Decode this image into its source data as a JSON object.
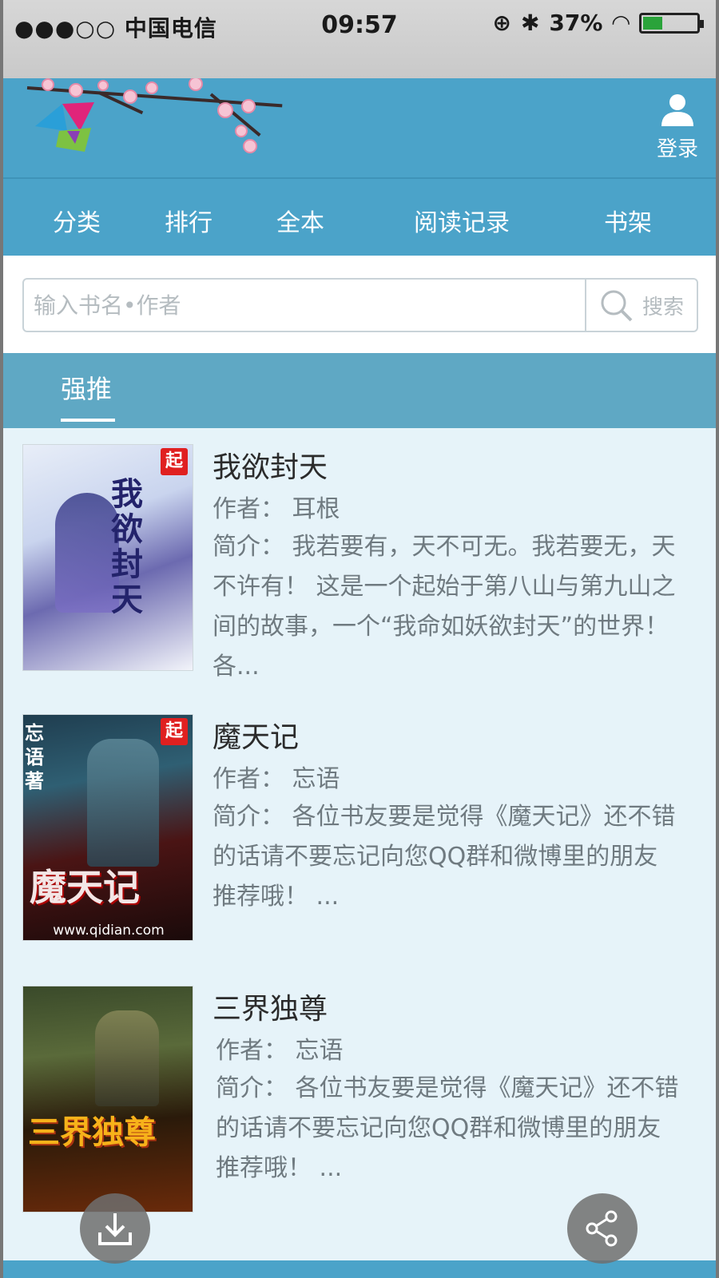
{
  "status_bar": {
    "carrier": "中国电信",
    "time": "09:57",
    "battery": "37%"
  },
  "header": {
    "login_label": "登录"
  },
  "nav": {
    "items": [
      "分类",
      "排行",
      "全本",
      "阅读记录",
      "书架"
    ]
  },
  "search": {
    "placeholder": "输入书名•作者",
    "button_label": "搜索"
  },
  "section": {
    "tab_label": "强推"
  },
  "books": [
    {
      "title": "我欲封天",
      "author": "作者：  耳根",
      "desc": "简介：  我若要有，天不可无。我若要无，天不许有！  这是一个起始于第八山与第九山之间的故事，一个“我命如妖欲封天”的世界！  各...",
      "cover_text": "我欲封天",
      "cover_badge": "起"
    },
    {
      "title": "魔天记",
      "author": "作者：  忘语",
      "desc": "简介：   各位书友要是觉得《魔天记》还不错的话请不要忘记向您QQ群和微博里的朋友推荐哦！  ...",
      "cover_text": "魔天记",
      "cover_side": "忘语著",
      "cover_url": "www.qidian.com",
      "cover_badge": "起"
    },
    {
      "title": "三界独尊",
      "author": "作者：  忘语",
      "desc": "简介：   各位书友要是觉得《魔天记》还不错的话请不要忘记向您QQ群和微博里的朋友推荐哦！  ...",
      "cover_text": "三界独尊"
    }
  ],
  "colors": {
    "header_blue": "#4ba3c9",
    "section_blue": "#5fa8c4",
    "list_bg": "#e6f3f9"
  },
  "icons": {
    "login": "user-icon",
    "search": "search-icon",
    "download": "download-icon",
    "share": "share-icon"
  }
}
